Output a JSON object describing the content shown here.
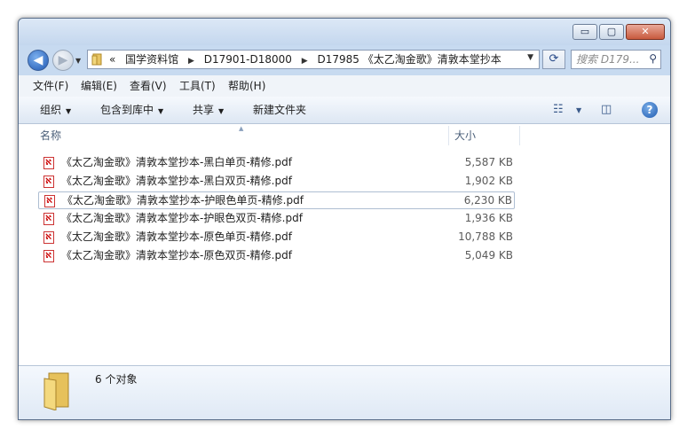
{
  "window": {
    "caption_buttons": {
      "minimize": "▭",
      "maximize": "▢",
      "close": "✕"
    }
  },
  "navigation": {
    "back_icon": "back-arrow-icon",
    "forward_icon": "forward-arrow-icon",
    "overflow": "«",
    "breadcrumb": [
      "国学资料馆",
      "D17901-D18000",
      "D17985 《太乙淘金歌》清敦本堂抄本"
    ],
    "search_placeholder": "搜索 D179..."
  },
  "menu": [
    "文件(F)",
    "编辑(E)",
    "查看(V)",
    "工具(T)",
    "帮助(H)"
  ],
  "commands": {
    "organize": "组织",
    "include_library": "包含到库中",
    "share": "共享",
    "new_folder": "新建文件夹"
  },
  "columns": {
    "name": "名称",
    "size": "大小"
  },
  "files": [
    {
      "name": "《太乙淘金歌》清敦本堂抄本-黑白单页-精修.pdf",
      "size": "5,587 KB"
    },
    {
      "name": "《太乙淘金歌》清敦本堂抄本-黑白双页-精修.pdf",
      "size": "1,902 KB"
    },
    {
      "name": "《太乙淘金歌》清敦本堂抄本-护眼色单页-精修.pdf",
      "size": "6,230 KB"
    },
    {
      "name": "《太乙淘金歌》清敦本堂抄本-护眼色双页-精修.pdf",
      "size": "1,936 KB"
    },
    {
      "name": "《太乙淘金歌》清敦本堂抄本-原色单页-精修.pdf",
      "size": "10,788 KB"
    },
    {
      "name": "《太乙淘金歌》清敦本堂抄本-原色双页-精修.pdf",
      "size": "5,049 KB"
    }
  ],
  "status": {
    "item_count": "6 个对象"
  },
  "colors": {
    "accent": "#1f58b3",
    "frame": "#c7daf0",
    "selection_border": "#aebed2"
  }
}
